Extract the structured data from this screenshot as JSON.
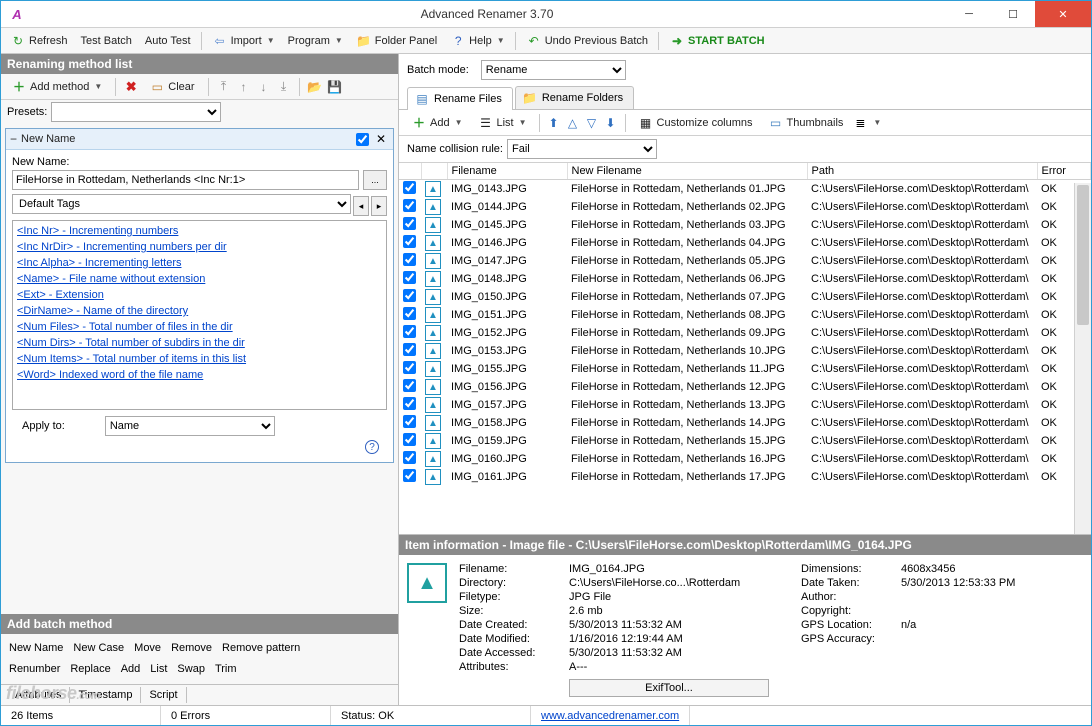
{
  "window": {
    "title": "Advanced Renamer 3.70"
  },
  "toolbar": {
    "refresh": "Refresh",
    "test": "Test Batch",
    "autotest": "Auto Test",
    "import": "Import",
    "program": "Program",
    "folderpanel": "Folder Panel",
    "help": "Help",
    "undo": "Undo Previous Batch",
    "start": "START BATCH"
  },
  "left": {
    "head": "Renaming method list",
    "addmethod": "Add method",
    "clear": "Clear",
    "presets_label": "Presets:",
    "method": {
      "title": "New Name",
      "label": "New Name:",
      "value": "FileHorse in Rottedam, Netherlands <Inc Nr:1>",
      "default_tags": "Default Tags",
      "tags": [
        "<Inc Nr> - Incrementing numbers",
        "<Inc NrDir> - Incrementing numbers per dir",
        "<Inc Alpha> - Incrementing letters",
        "<Name> - File name without extension",
        "<Ext> - Extension",
        "<DirName> - Name of the directory",
        "<Num Files> - Total number of files in the dir",
        "<Num Dirs> - Total number of subdirs in the dir",
        "<Num Items> - Total number of items in this list",
        "<Word> Indexed word of the file name"
      ],
      "applyto_label": "Apply to:",
      "applyto_value": "Name"
    },
    "batchhead": "Add batch method",
    "batchmethods_r1": [
      "New Name",
      "New Case",
      "Move",
      "Remove",
      "Remove pattern"
    ],
    "batchmethods_r2": [
      "Renumber",
      "Replace",
      "Add",
      "List",
      "Swap",
      "Trim"
    ],
    "batchtabs": [
      "Attributes",
      "Timestamp",
      "Script"
    ]
  },
  "right": {
    "batchmode_label": "Batch mode:",
    "batchmode_value": "Rename",
    "tabs": {
      "files": "Rename Files",
      "folders": "Rename Folders"
    },
    "filetoolbar": {
      "add": "Add",
      "list": "List",
      "customize": "Customize columns",
      "thumbs": "Thumbnails"
    },
    "collision_label": "Name collision rule:",
    "collision_value": "Fail",
    "columns": {
      "filename": "Filename",
      "newfilename": "New Filename",
      "path": "Path",
      "error": "Error"
    },
    "rows": [
      {
        "f": "IMG_0143.JPG",
        "n": "FileHorse in Rottedam, Netherlands 01.JPG",
        "p": "C:\\Users\\FileHorse.com\\Desktop\\Rotterdam\\",
        "e": "OK"
      },
      {
        "f": "IMG_0144.JPG",
        "n": "FileHorse in Rottedam, Netherlands 02.JPG",
        "p": "C:\\Users\\FileHorse.com\\Desktop\\Rotterdam\\",
        "e": "OK"
      },
      {
        "f": "IMG_0145.JPG",
        "n": "FileHorse in Rottedam, Netherlands 03.JPG",
        "p": "C:\\Users\\FileHorse.com\\Desktop\\Rotterdam\\",
        "e": "OK"
      },
      {
        "f": "IMG_0146.JPG",
        "n": "FileHorse in Rottedam, Netherlands 04.JPG",
        "p": "C:\\Users\\FileHorse.com\\Desktop\\Rotterdam\\",
        "e": "OK"
      },
      {
        "f": "IMG_0147.JPG",
        "n": "FileHorse in Rottedam, Netherlands 05.JPG",
        "p": "C:\\Users\\FileHorse.com\\Desktop\\Rotterdam\\",
        "e": "OK"
      },
      {
        "f": "IMG_0148.JPG",
        "n": "FileHorse in Rottedam, Netherlands 06.JPG",
        "p": "C:\\Users\\FileHorse.com\\Desktop\\Rotterdam\\",
        "e": "OK"
      },
      {
        "f": "IMG_0150.JPG",
        "n": "FileHorse in Rottedam, Netherlands 07.JPG",
        "p": "C:\\Users\\FileHorse.com\\Desktop\\Rotterdam\\",
        "e": "OK"
      },
      {
        "f": "IMG_0151.JPG",
        "n": "FileHorse in Rottedam, Netherlands 08.JPG",
        "p": "C:\\Users\\FileHorse.com\\Desktop\\Rotterdam\\",
        "e": "OK"
      },
      {
        "f": "IMG_0152.JPG",
        "n": "FileHorse in Rottedam, Netherlands 09.JPG",
        "p": "C:\\Users\\FileHorse.com\\Desktop\\Rotterdam\\",
        "e": "OK"
      },
      {
        "f": "IMG_0153.JPG",
        "n": "FileHorse in Rottedam, Netherlands 10.JPG",
        "p": "C:\\Users\\FileHorse.com\\Desktop\\Rotterdam\\",
        "e": "OK"
      },
      {
        "f": "IMG_0155.JPG",
        "n": "FileHorse in Rottedam, Netherlands 11.JPG",
        "p": "C:\\Users\\FileHorse.com\\Desktop\\Rotterdam\\",
        "e": "OK"
      },
      {
        "f": "IMG_0156.JPG",
        "n": "FileHorse in Rottedam, Netherlands 12.JPG",
        "p": "C:\\Users\\FileHorse.com\\Desktop\\Rotterdam\\",
        "e": "OK"
      },
      {
        "f": "IMG_0157.JPG",
        "n": "FileHorse in Rottedam, Netherlands 13.JPG",
        "p": "C:\\Users\\FileHorse.com\\Desktop\\Rotterdam\\",
        "e": "OK"
      },
      {
        "f": "IMG_0158.JPG",
        "n": "FileHorse in Rottedam, Netherlands 14.JPG",
        "p": "C:\\Users\\FileHorse.com\\Desktop\\Rotterdam\\",
        "e": "OK"
      },
      {
        "f": "IMG_0159.JPG",
        "n": "FileHorse in Rottedam, Netherlands 15.JPG",
        "p": "C:\\Users\\FileHorse.com\\Desktop\\Rotterdam\\",
        "e": "OK"
      },
      {
        "f": "IMG_0160.JPG",
        "n": "FileHorse in Rottedam, Netherlands 16.JPG",
        "p": "C:\\Users\\FileHorse.com\\Desktop\\Rotterdam\\",
        "e": "OK"
      },
      {
        "f": "IMG_0161.JPG",
        "n": "FileHorse in Rottedam, Netherlands 17.JPG",
        "p": "C:\\Users\\FileHorse.com\\Desktop\\Rotterdam\\",
        "e": "OK"
      }
    ],
    "info": {
      "head": "Item information - Image file - C:\\Users\\FileHorse.com\\Desktop\\Rotterdam\\IMG_0164.JPG",
      "filename_l": "Filename:",
      "filename": "IMG_0164.JPG",
      "directory_l": "Directory:",
      "directory": "C:\\Users\\FileHorse.co...\\Rotterdam",
      "filetype_l": "Filetype:",
      "filetype": "JPG File",
      "size_l": "Size:",
      "size": "2.6 mb",
      "created_l": "Date Created:",
      "created": "5/30/2013 11:53:32 AM",
      "modified_l": "Date Modified:",
      "modified": "1/16/2016 12:19:44 AM",
      "accessed_l": "Date Accessed:",
      "accessed": "5/30/2013 11:53:32 AM",
      "attrs_l": "Attributes:",
      "attrs": "A---",
      "exif": "ExifTool...",
      "dim_l": "Dimensions:",
      "dim": "4608x3456",
      "taken_l": "Date Taken:",
      "taken": "5/30/2013 12:53:33 PM",
      "author_l": "Author:",
      "author": "",
      "copy_l": "Copyright:",
      "copy": "",
      "gpsloc_l": "GPS Location:",
      "gpsloc": "n/a",
      "gpsacc_l": "GPS Accuracy:",
      "gpsacc": ""
    }
  },
  "status": {
    "items": "26 Items",
    "errors": "0 Errors",
    "ok": "Status: OK",
    "url": "www.advancedrenamer.com"
  }
}
